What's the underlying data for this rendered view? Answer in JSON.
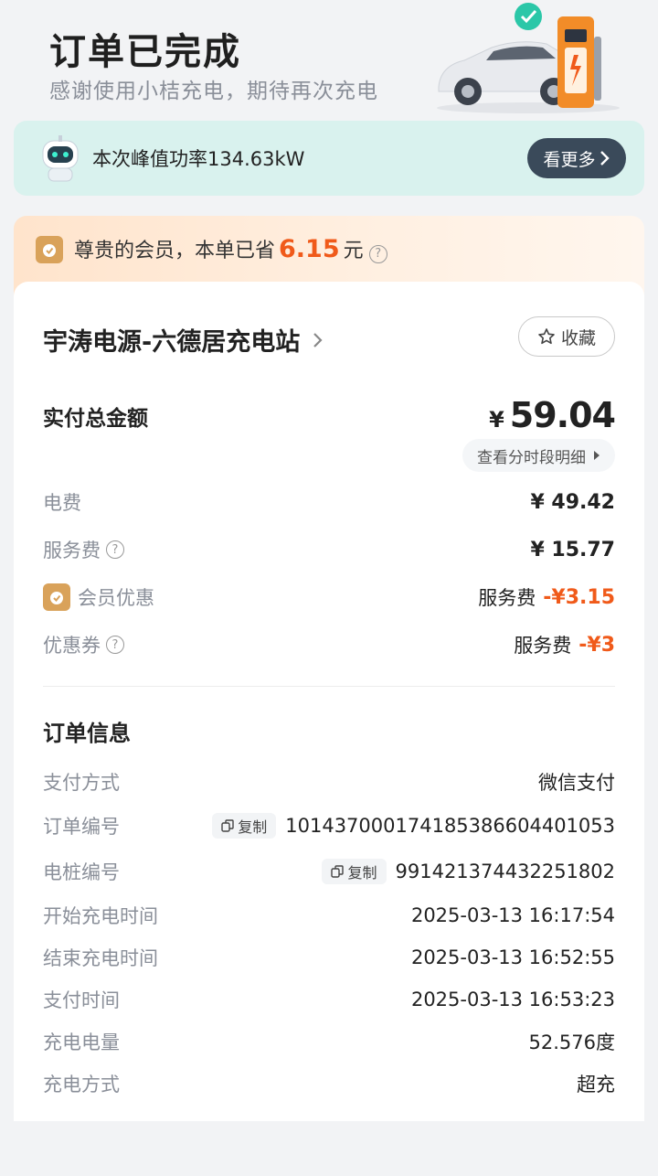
{
  "header": {
    "title": "订单已完成",
    "subtitle": "感谢使用小桔充电，期待再次充电"
  },
  "peak": {
    "text": "本次峰值功率134.63kW",
    "more_label": "看更多"
  },
  "member": {
    "prefix": "尊贵的会员，本单已省",
    "saved": "6.15",
    "unit": "元"
  },
  "station": {
    "name": "宇涛电源-六德居充电站",
    "fav_label": "收藏"
  },
  "total": {
    "label": "实付总金额",
    "currency": "¥",
    "amount": "59.04",
    "detail_link": "查看分时段明细"
  },
  "fees": [
    {
      "label": "电费",
      "value": "¥ 49.42"
    },
    {
      "label": "服务费",
      "value": "¥ 15.77"
    },
    {
      "label": "会员优惠",
      "prefix": "服务费",
      "value": "-¥3.15"
    },
    {
      "label": "优惠券",
      "prefix": "服务费",
      "value": "-¥3"
    }
  ],
  "order_info": {
    "title": "订单信息",
    "copy_label": "复制",
    "rows": [
      {
        "label": "支付方式",
        "value": "微信支付"
      },
      {
        "label": "订单编号",
        "value": "1014370001741853866044010​53"
      },
      {
        "label": "电桩编号",
        "value": "991421374432251802"
      },
      {
        "label": "开始充电时间",
        "value": "2025-03-13 16:17:54"
      },
      {
        "label": "结束充电时间",
        "value": "2025-03-13 16:52:55"
      },
      {
        "label": "支付时间",
        "value": "2025-03-13 16:53:23"
      },
      {
        "label": "充电电量",
        "value": "52.576度"
      },
      {
        "label": "充电方式",
        "value": "超充"
      }
    ]
  },
  "colors": {
    "accent_orange": "#f05a1a",
    "peak_bg": "#d9f2ee",
    "dark_button": "#3a4a5a",
    "muted_text": "#8a8f99"
  }
}
